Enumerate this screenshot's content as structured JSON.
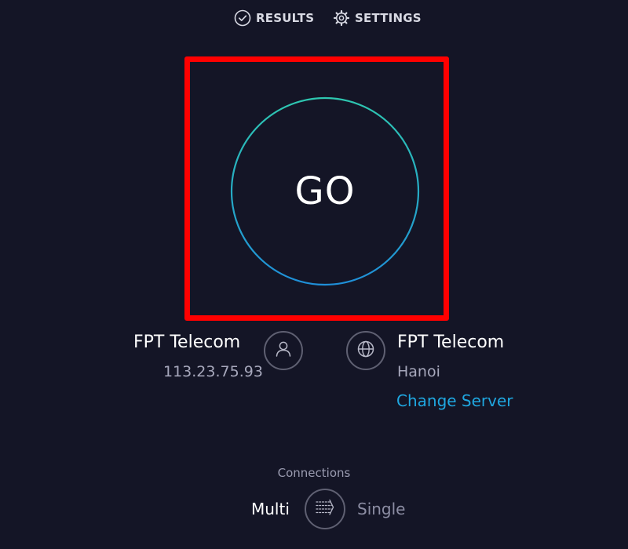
{
  "nav": {
    "results_label": "RESULTS",
    "settings_label": "SETTINGS"
  },
  "go_button": {
    "label": "GO"
  },
  "isp": {
    "name": "FPT Telecom",
    "ip": "113.23.75.93"
  },
  "server": {
    "name": "FPT Telecom",
    "location": "Hanoi",
    "change_label": "Change Server"
  },
  "connections": {
    "title": "Connections",
    "multi_label": "Multi",
    "single_label": "Single"
  },
  "colors": {
    "background": "#141526",
    "highlight": "#ff0000",
    "ring_start": "#2ec7b0",
    "ring_end": "#1f8fd8",
    "link": "#1fa7e0"
  },
  "icons": {
    "results": "check-circle-icon",
    "settings": "gear-icon",
    "isp": "person-icon",
    "server": "globe-icon",
    "connections": "multi-connection-icon"
  }
}
